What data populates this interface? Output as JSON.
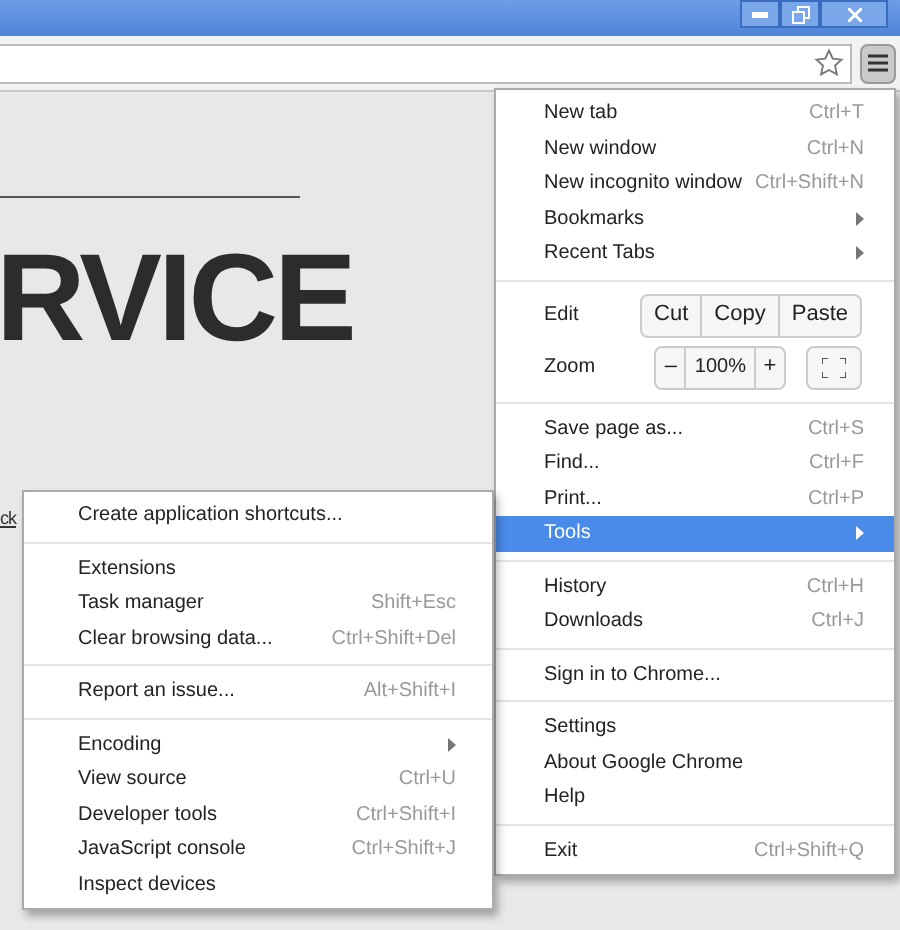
{
  "page": {
    "heading": "RVICE",
    "link": "ck"
  },
  "menu": {
    "sections": [
      [
        {
          "kind": "item",
          "label": "New tab",
          "shortcut": "Ctrl+T",
          "submenu": false,
          "selected": false
        },
        {
          "kind": "item",
          "label": "New window",
          "shortcut": "Ctrl+N",
          "submenu": false,
          "selected": false
        },
        {
          "kind": "item",
          "label": "New incognito window",
          "shortcut": "Ctrl+Shift+N",
          "submenu": false,
          "selected": false
        },
        {
          "kind": "item",
          "label": "Bookmarks",
          "submenu": true,
          "selected": false
        },
        {
          "kind": "item",
          "label": "Recent Tabs",
          "submenu": true,
          "selected": false
        }
      ],
      [
        {
          "kind": "edit",
          "label": "Edit",
          "buttons": [
            "Cut",
            "Copy",
            "Paste"
          ]
        },
        {
          "kind": "zoom",
          "label": "Zoom",
          "minus": "–",
          "value": "100%",
          "plus": "+"
        }
      ],
      [
        {
          "kind": "item",
          "label": "Save page as...",
          "shortcut": "Ctrl+S",
          "submenu": false,
          "selected": false
        },
        {
          "kind": "item",
          "label": "Find...",
          "shortcut": "Ctrl+F",
          "submenu": false,
          "selected": false
        },
        {
          "kind": "item",
          "label": "Print...",
          "shortcut": "Ctrl+P",
          "submenu": false,
          "selected": false
        },
        {
          "kind": "item",
          "label": "Tools",
          "submenu": true,
          "selected": true
        }
      ],
      [
        {
          "kind": "item",
          "label": "History",
          "shortcut": "Ctrl+H",
          "submenu": false,
          "selected": false
        },
        {
          "kind": "item",
          "label": "Downloads",
          "shortcut": "Ctrl+J",
          "submenu": false,
          "selected": false
        }
      ],
      [
        {
          "kind": "item",
          "label": "Sign in to Chrome...",
          "submenu": false,
          "selected": false
        }
      ],
      [
        {
          "kind": "item",
          "label": "Settings",
          "submenu": false,
          "selected": false
        },
        {
          "kind": "item",
          "label": "About Google Chrome",
          "submenu": false,
          "selected": false
        },
        {
          "kind": "item",
          "label": "Help",
          "submenu": false,
          "selected": false
        }
      ],
      [
        {
          "kind": "item",
          "label": "Exit",
          "shortcut": "Ctrl+Shift+Q",
          "submenu": false,
          "selected": false
        }
      ]
    ]
  },
  "submenu": {
    "sections": [
      [
        {
          "kind": "item",
          "label": "Create application shortcuts...",
          "submenu": false,
          "selected": false
        }
      ],
      [
        {
          "kind": "item",
          "label": "Extensions",
          "submenu": false,
          "selected": false
        },
        {
          "kind": "item",
          "label": "Task manager",
          "shortcut": "Shift+Esc",
          "submenu": false,
          "selected": false
        },
        {
          "kind": "item",
          "label": "Clear browsing data...",
          "shortcut": "Ctrl+Shift+Del",
          "submenu": false,
          "selected": false
        }
      ],
      [
        {
          "kind": "item",
          "label": "Report an issue...",
          "shortcut": "Alt+Shift+I",
          "submenu": false,
          "selected": false
        }
      ],
      [
        {
          "kind": "item",
          "label": "Encoding",
          "submenu": true,
          "selected": false
        },
        {
          "kind": "item",
          "label": "View source",
          "shortcut": "Ctrl+U",
          "submenu": false,
          "selected": false
        },
        {
          "kind": "item",
          "label": "Developer tools",
          "shortcut": "Ctrl+Shift+I",
          "submenu": false,
          "selected": false
        },
        {
          "kind": "item",
          "label": "JavaScript console",
          "shortcut": "Ctrl+Shift+J",
          "submenu": false,
          "selected": false
        },
        {
          "kind": "item",
          "label": "Inspect devices",
          "submenu": false,
          "selected": false
        }
      ]
    ]
  }
}
